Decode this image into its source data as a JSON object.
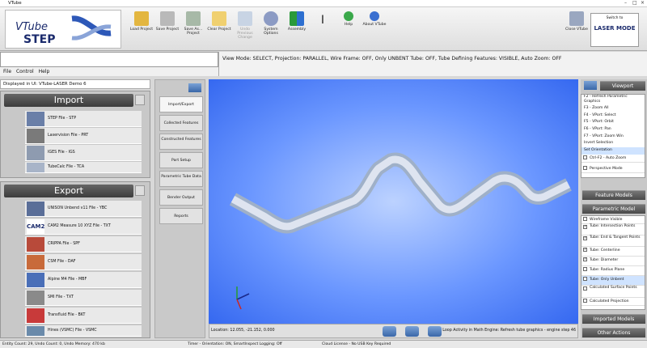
{
  "window": {
    "title": "VTube"
  },
  "toolbar": {
    "logo_text": "VTube STEP",
    "buttons": [
      {
        "label": "Load Project",
        "icon": "load-project-icon",
        "enabled": true
      },
      {
        "label": "Save Project",
        "icon": "save-project-icon",
        "enabled": true
      },
      {
        "label": "Save As... Project",
        "icon": "save-as-icon",
        "enabled": true
      },
      {
        "label": "Clear Project",
        "icon": "clear-project-icon",
        "enabled": true
      },
      {
        "label": "Undo Previous Change",
        "icon": "undo-icon",
        "enabled": false
      },
      {
        "label": "System Options",
        "icon": "gear-icon",
        "enabled": true
      },
      {
        "label": "Assembly",
        "icon": "assembly-icon",
        "enabled": true
      },
      {
        "label": "Help",
        "icon": "help-icon",
        "enabled": true
      },
      {
        "label": "About VTube",
        "icon": "info-icon",
        "enabled": true
      },
      {
        "label": "Close VTube",
        "icon": "close-vtube-icon",
        "enabled": true
      }
    ],
    "switch_label": "Switch to",
    "switch_mode": "LASER MODE"
  },
  "menu": {
    "items": [
      "File",
      "Control",
      "Help"
    ]
  },
  "status_line": "View Mode: SELECT, Projection: PARALLEL, Wire Frame: OFF, Only UNBENT Tube: OFF, Tube Defining Features: VISIBLE, Auto Zoom: OFF",
  "displayed": {
    "label": "Displayed in UI:",
    "value": "VTube-LASER Demo 6"
  },
  "import": {
    "title": "Import",
    "items": [
      "STEP File - STP",
      "Laservision File - PRT",
      "IGES File - IGS",
      "TubeCalc File - TCA"
    ]
  },
  "export": {
    "title": "Export",
    "items": [
      "UNISON Unbend v11 File - YBC",
      "CAM2 Measure 10 XYZ File - TXT",
      "CRIPPA File - SPF",
      "CSM File - DAF",
      "Alpine M4 File - MBF",
      "SMI File - TXT",
      "Transfluid File - BKT",
      "Hines (VSMC) File - VSMC"
    ]
  },
  "tabs": [
    "Import/Export",
    "Collected Features",
    "Constructed Features",
    "Part Setup",
    "Parametric Tube Data",
    "Bender Output",
    "Reports"
  ],
  "viewport": {
    "location": "Location: 12.055, -21.152, 0.000",
    "loop": "Loop Activity in Math Engine:  Refresh tube graphics - engine step 46"
  },
  "right_panel": {
    "viewport_title": "Viewport",
    "keys": [
      "F2 - Refresh Parametric Graphics",
      "F3 - Zoom All",
      "F4 - VPort: Select",
      "F5 - VPort: Orbit",
      "F6 - VPort: Pan",
      "F7 - VPort: Zoom Win",
      "Invert Selection",
      "Set Orientation"
    ],
    "checks_top": [
      {
        "label": "Ctrl-F2 - Auto Zoom",
        "checked": false
      },
      {
        "label": "Perspective Mode",
        "checked": false
      }
    ],
    "feature_models": "Feature Models",
    "parametric_model": "Parametric Model",
    "param_checks": [
      {
        "label": "Wireframe Visible",
        "checked": false
      },
      {
        "label": "Tube: Intersection Points",
        "checked": true
      },
      {
        "label": "Tube: End & Tangent Points",
        "checked": true
      },
      {
        "label": "Tube: Centerline",
        "checked": true
      },
      {
        "label": "Tube: Diameter",
        "checked": true
      },
      {
        "label": "Tube: Radius Plane",
        "checked": false
      },
      {
        "label": "Tube: Only Unbent",
        "checked": false
      },
      {
        "label": "Calculated Surface Points",
        "checked": false
      },
      {
        "label": "Calculated Projection",
        "checked": false
      }
    ],
    "imported_models": "Imported Models",
    "other_actions": "Other Actions"
  },
  "footer": {
    "left": "Entity Count: 29, Undo Count: 0, Undo Memory: 470 kb",
    "mid": "Timer - Orientation: ON, SmartInspect Logging: Off",
    "right": "Cloud License - No USB Key Required"
  },
  "colors": {
    "viewport_center": "#bcd2ff",
    "viewport_edge": "#3568f0",
    "header_dark": "#3c3c3c"
  }
}
